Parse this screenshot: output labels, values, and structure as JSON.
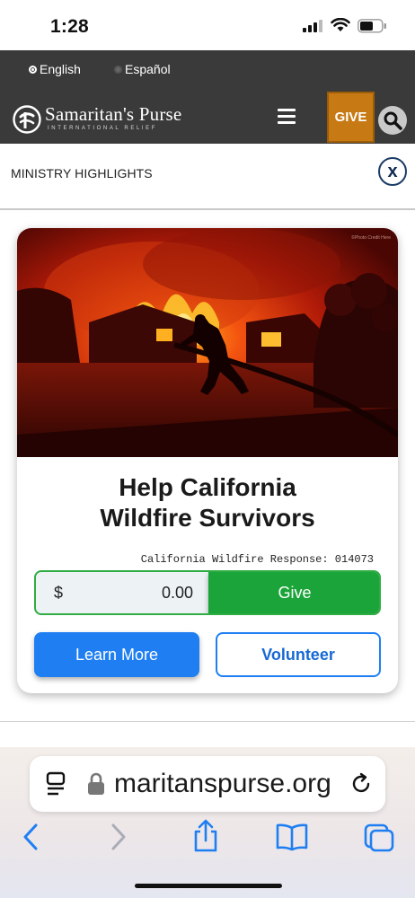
{
  "status": {
    "time": "1:28"
  },
  "language": {
    "options": [
      "English",
      "Español"
    ],
    "selected": "English"
  },
  "header": {
    "brand": "Samaritan's Purse",
    "brand_sub": "INTERNATIONAL RELIEF",
    "give_label": "GIVE"
  },
  "ministry": {
    "title": "MINISTRY HIGHLIGHTS",
    "close_label": "x"
  },
  "card": {
    "photo_credit": "©Photo Credit Here",
    "headline_line1": "Help California",
    "headline_line2": "Wildfire Survivors",
    "fund_code": "California Wildfire Response: 014073",
    "currency": "$",
    "amount_value": "0.00",
    "give_label": "Give",
    "learn_more_label": "Learn More",
    "volunteer_label": "Volunteer"
  },
  "browser": {
    "url": "maritanspurse.org"
  },
  "colors": {
    "give_accent": "#c77a14",
    "donate_green": "#1ba43a",
    "primary_blue": "#1f7ff2",
    "header_dark": "#3a3a3a"
  }
}
